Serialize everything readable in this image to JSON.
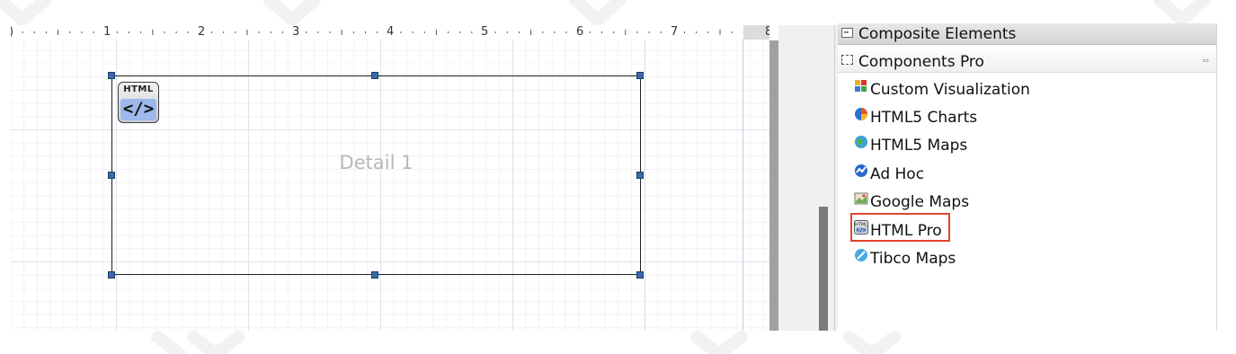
{
  "designer": {
    "ruler": {
      "start_label": ")",
      "numbers": [
        "1",
        "2",
        "3",
        "4",
        "5",
        "6",
        "7",
        "8"
      ]
    },
    "detail_box": {
      "label": "Detail 1",
      "badge": {
        "top_text": "HTML",
        "bottom_text": "</>"
      }
    }
  },
  "palette": {
    "categories": [
      {
        "label": "Composite Elements",
        "icon": "composite-elements-icon"
      },
      {
        "label": "Components Pro",
        "icon": "components-pro-icon",
        "collapse_glyph": "⇔"
      }
    ],
    "items": [
      {
        "label": "Custom Visualization",
        "icon": "custom-visualization-icon"
      },
      {
        "label": "HTML5 Charts",
        "icon": "html5-charts-icon"
      },
      {
        "label": "HTML5 Maps",
        "icon": "html5-maps-icon"
      },
      {
        "label": "Ad Hoc",
        "icon": "ad-hoc-icon"
      },
      {
        "label": "Google Maps",
        "icon": "google-maps-icon"
      },
      {
        "label": "HTML Pro",
        "icon": "html-pro-icon",
        "highlighted": true
      },
      {
        "label": "Tibco Maps",
        "icon": "tibco-maps-icon"
      }
    ],
    "highlight_color": "#e4432c"
  },
  "colors": {
    "handle": "#3a6aa8",
    "scroll_thumb": "#7a7a7a",
    "splitter": "#a0a0a0"
  }
}
